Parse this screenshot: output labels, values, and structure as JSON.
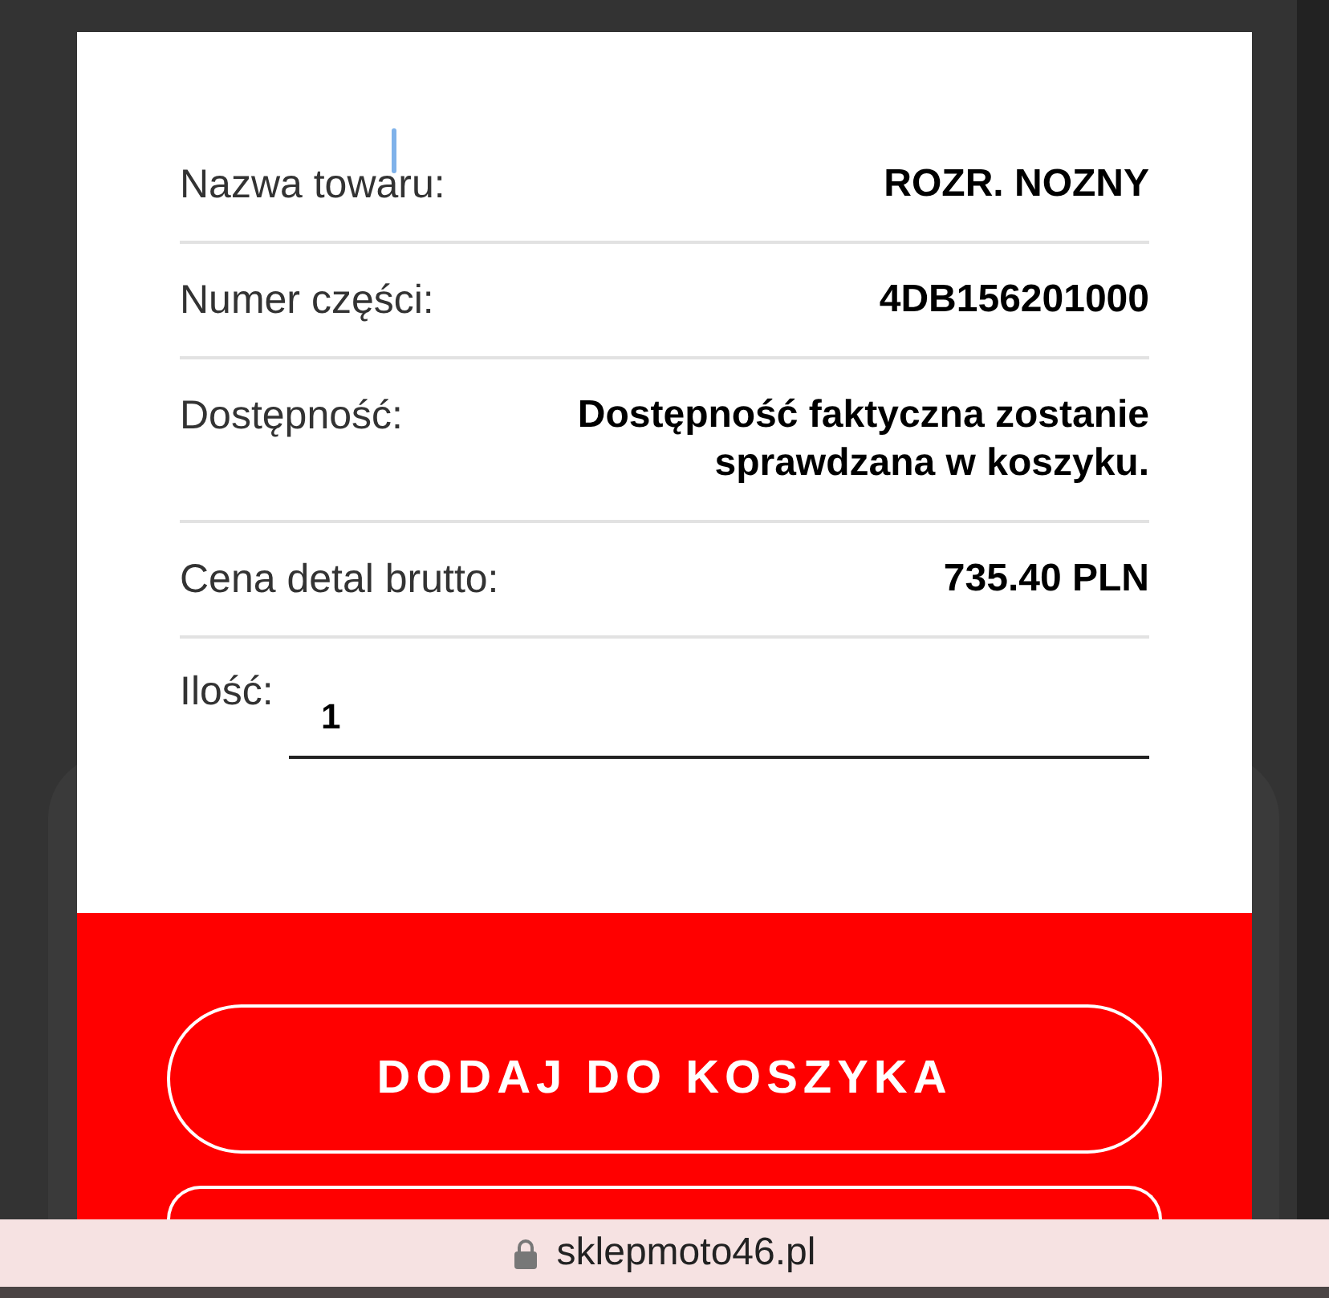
{
  "product": {
    "fields": [
      {
        "label": "Nazwa towaru:",
        "value": "ROZR. NOZNY"
      },
      {
        "label": "Numer części:",
        "value": "4DB156201000"
      },
      {
        "label": "Dostępność:",
        "value": "Dostępność faktyczna zostanie sprawdzana w koszyku."
      },
      {
        "label": "Cena detal brutto:",
        "value": "735.40 PLN"
      }
    ],
    "quantity": {
      "label": "Ilość:",
      "value": "1"
    }
  },
  "actions": {
    "add_to_cart": "DODAJ DO KOSZYKA"
  },
  "address_bar": {
    "url": "sklepmoto46.pl",
    "secure": true
  }
}
